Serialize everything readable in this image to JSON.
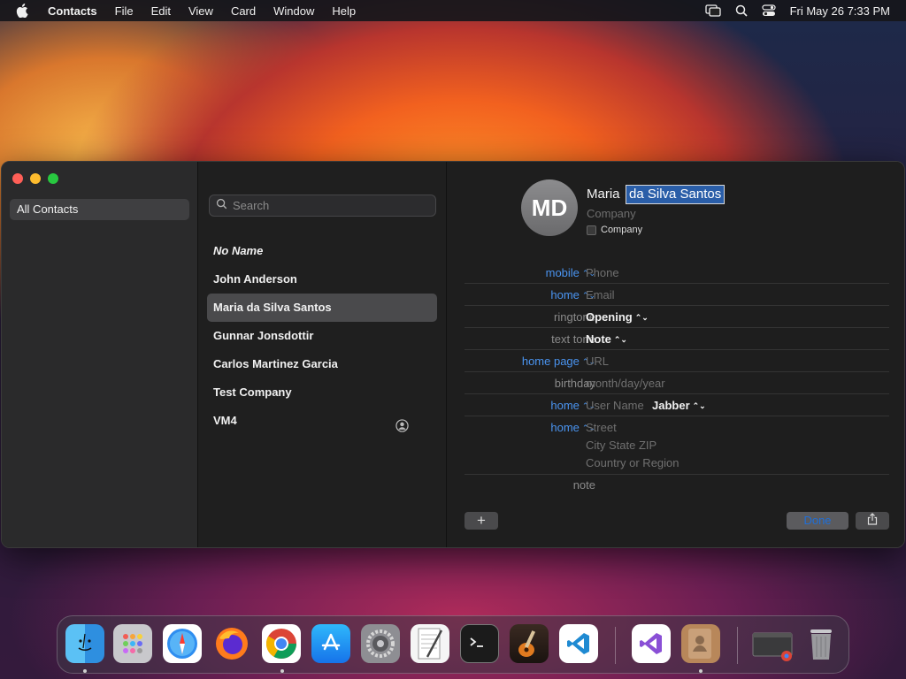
{
  "menubar": {
    "app_name": "Contacts",
    "items": [
      "File",
      "Edit",
      "View",
      "Card",
      "Window",
      "Help"
    ],
    "clock": "Fri May 26  7:33 PM"
  },
  "sidebar": {
    "items": [
      {
        "label": "All Contacts"
      }
    ]
  },
  "search": {
    "placeholder": "Search"
  },
  "contacts": [
    {
      "label": "No Name"
    },
    {
      "label": "John Anderson"
    },
    {
      "label": "Maria da Silva Santos"
    },
    {
      "label": "Gunnar Jonsdottir"
    },
    {
      "label": "Carlos Martinez Garcia"
    },
    {
      "label": "Test Company"
    },
    {
      "label": "VM4"
    }
  ],
  "selected_contact": "Maria da Silva Santos",
  "card": {
    "initials": "MD",
    "first_name": "Maria",
    "last_name": "da Silva Santos",
    "company_placeholder": "Company",
    "company_checkbox_label": "Company",
    "fields": [
      {
        "label": "mobile",
        "value": "Phone",
        "label_style": "blue",
        "value_style": "placeholder"
      },
      {
        "label": "home",
        "value": "Email",
        "label_style": "blue",
        "value_style": "placeholder"
      },
      {
        "label": "ringtone",
        "value": "Opening",
        "label_style": "gray",
        "value_style": "select"
      },
      {
        "label": "text tone",
        "value": "Note",
        "label_style": "gray",
        "value_style": "select"
      },
      {
        "label": "home page",
        "value": "URL",
        "label_style": "blue",
        "value_style": "placeholder"
      },
      {
        "label": "birthday",
        "value": "month/day/year",
        "label_style": "gray",
        "value_style": "placeholder"
      },
      {
        "label": "home",
        "value": "User Name",
        "extra": "Jabber",
        "label_style": "blue",
        "value_style": "placeholder"
      }
    ],
    "address": {
      "label": "home",
      "street": "Street",
      "city": "City  State  ZIP",
      "country": "Country or Region"
    },
    "note_label": "note",
    "add_label": "+",
    "done_label": "Done"
  },
  "dock": {
    "apps": [
      "finder",
      "launchpad",
      "safari",
      "firefox",
      "chrome",
      "app-store",
      "system-settings",
      "textedit",
      "terminal",
      "garageband",
      "vscode",
      "visual-studio",
      "contacts",
      "chrome-window",
      "trash"
    ]
  },
  "colors": {
    "accent": "#4a94f0",
    "selection": "#2a5ea8"
  }
}
